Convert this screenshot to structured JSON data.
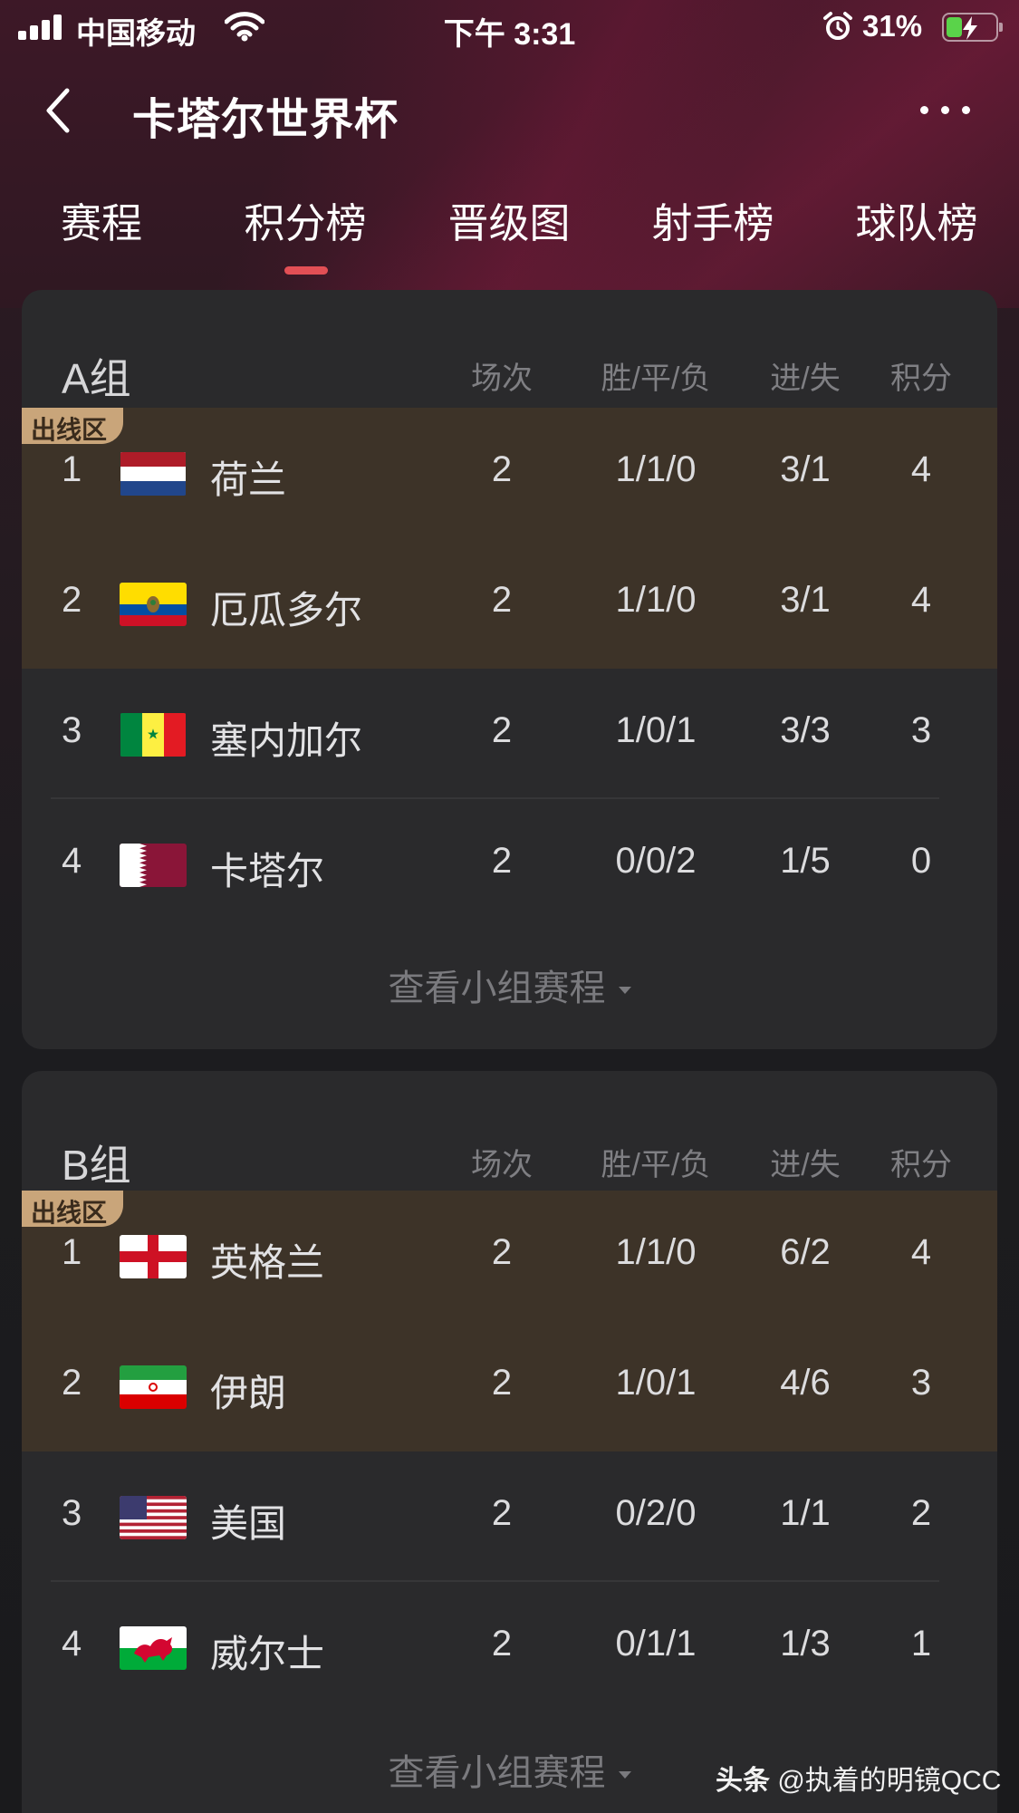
{
  "status_bar": {
    "carrier": "中国移动",
    "time": "下午 3:31",
    "battery_percent": "31%",
    "battery_level": 0.31
  },
  "header": {
    "title": "卡塔尔世界杯"
  },
  "tabs": [
    {
      "label": "赛程",
      "selected": false
    },
    {
      "label": "积分榜",
      "selected": true
    },
    {
      "label": "晋级图",
      "selected": false
    },
    {
      "label": "射手榜",
      "selected": false
    },
    {
      "label": "球队榜",
      "selected": false
    }
  ],
  "columns": {
    "played": "场次",
    "wdl": "胜/平/负",
    "goals": "进/失",
    "points": "积分"
  },
  "zone_label": "出线区",
  "view_schedule_label": "查看小组赛程",
  "groups": [
    {
      "name": "A组",
      "rows": [
        {
          "rank": "1",
          "team": "荷兰",
          "flag": "netherlands-flag",
          "played": "2",
          "wdl": "1/1/0",
          "goals": "3/1",
          "points": "4",
          "qualified": true
        },
        {
          "rank": "2",
          "team": "厄瓜多尔",
          "flag": "ecuador-flag",
          "played": "2",
          "wdl": "1/1/0",
          "goals": "3/1",
          "points": "4",
          "qualified": true
        },
        {
          "rank": "3",
          "team": "塞内加尔",
          "flag": "senegal-flag",
          "played": "2",
          "wdl": "1/0/1",
          "goals": "3/3",
          "points": "3",
          "qualified": false
        },
        {
          "rank": "4",
          "team": "卡塔尔",
          "flag": "qatar-flag",
          "played": "2",
          "wdl": "0/0/2",
          "goals": "1/5",
          "points": "0",
          "qualified": false
        }
      ]
    },
    {
      "name": "B组",
      "rows": [
        {
          "rank": "1",
          "team": "英格兰",
          "flag": "england-flag",
          "played": "2",
          "wdl": "1/1/0",
          "goals": "6/2",
          "points": "4",
          "qualified": true
        },
        {
          "rank": "2",
          "team": "伊朗",
          "flag": "iran-flag",
          "played": "2",
          "wdl": "1/0/1",
          "goals": "4/6",
          "points": "3",
          "qualified": true
        },
        {
          "rank": "3",
          "team": "美国",
          "flag": "usa-flag",
          "played": "2",
          "wdl": "0/2/0",
          "goals": "1/1",
          "points": "2",
          "qualified": false
        },
        {
          "rank": "4",
          "team": "威尔士",
          "flag": "wales-flag",
          "played": "2",
          "wdl": "0/1/1",
          "goals": "1/3",
          "points": "1",
          "qualified": false
        }
      ]
    }
  ],
  "watermark": {
    "brand": "头条",
    "handle": "@执着的明镜QCC"
  },
  "colors": {
    "accent": "#e24f55",
    "qualified_row": "#3d3328",
    "zone_tag": "#c9a57a",
    "card": "#2a2a2c"
  }
}
